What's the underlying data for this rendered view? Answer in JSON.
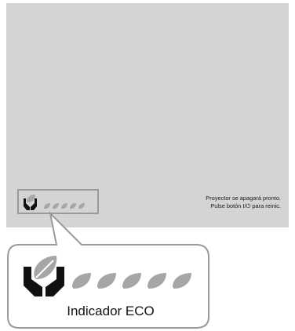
{
  "screen": {
    "background_color": "#d4d4d4",
    "message_line1": "Proyector se apagará pronto.",
    "message_line2_before": "Pulse botón ",
    "message_line2_symbol": "I/⏻",
    "message_line2_after": " para reinic."
  },
  "eco_indicator": {
    "label": "Indicador ECO",
    "leaf_count": 5,
    "hands_icon": "hands-holding-leaf-icon",
    "leaf_icon": "leaf-icon",
    "leaf_color": "#a6a6a6",
    "hands_color": "#111111"
  },
  "frame_color": "#9a9a9a"
}
